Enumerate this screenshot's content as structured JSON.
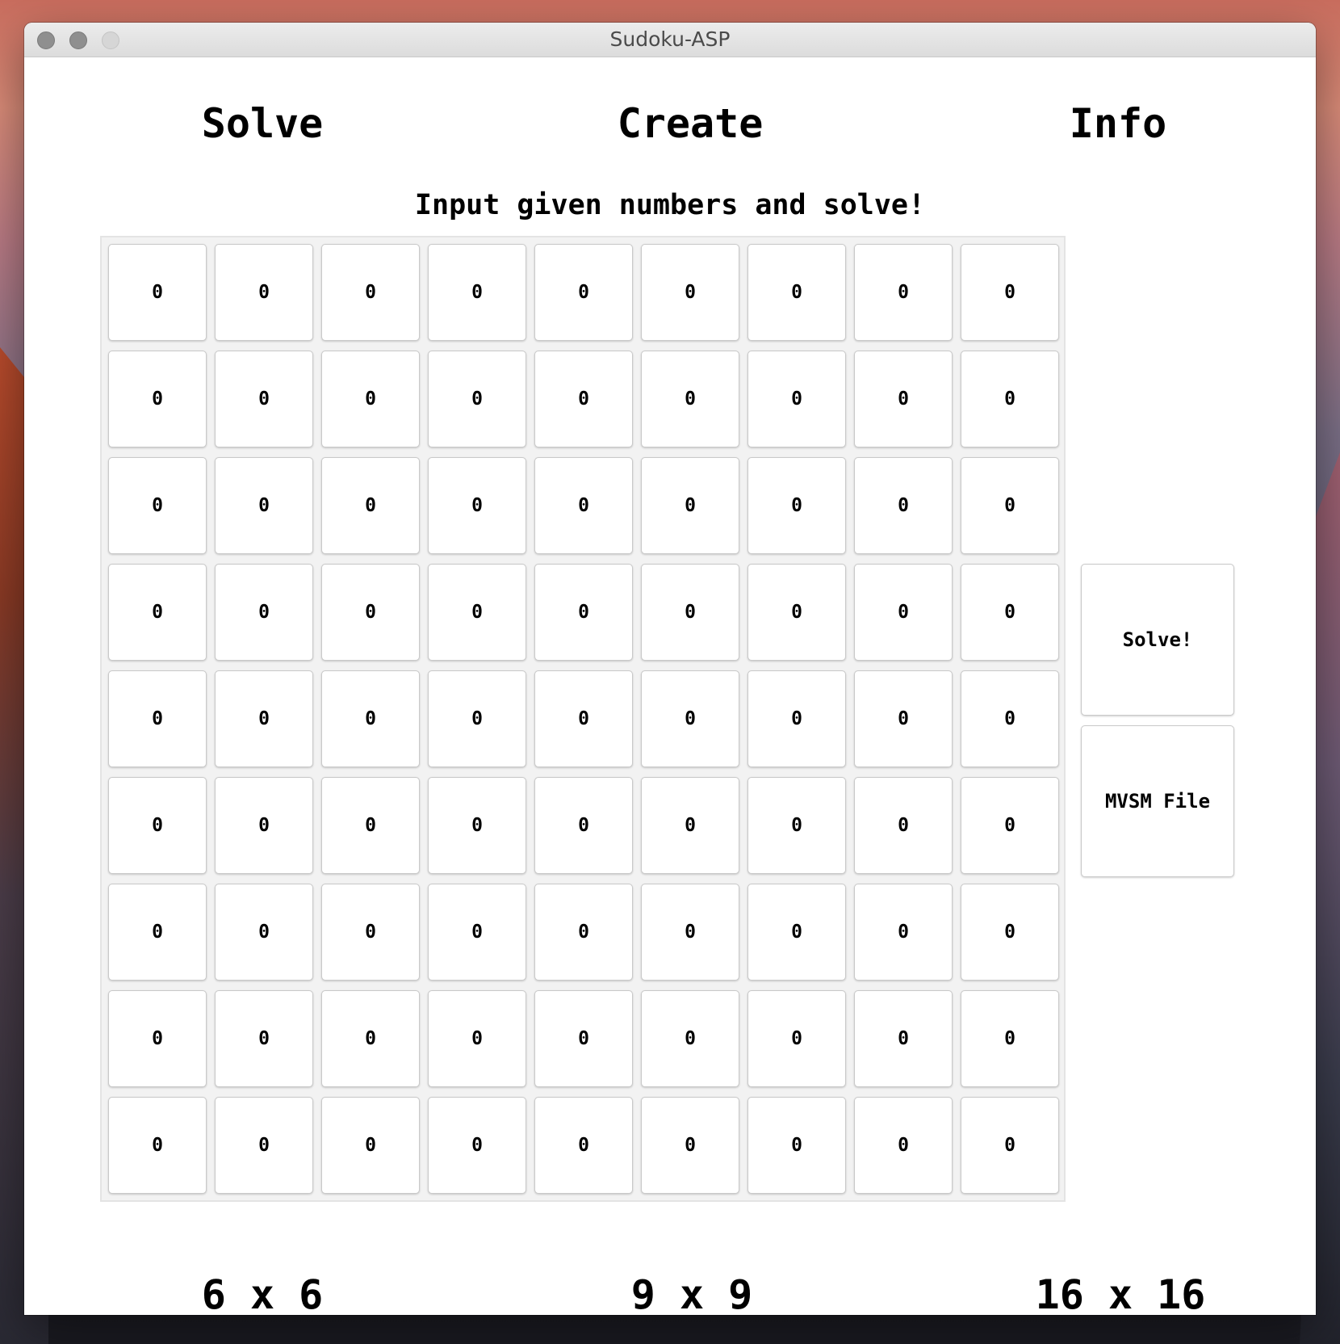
{
  "window": {
    "title": "Sudoku-ASP"
  },
  "nav": {
    "solve": "Solve",
    "create": "Create",
    "info": "Info"
  },
  "instruction": "Input given numbers and solve!",
  "board": {
    "rows": 9,
    "cols": 9,
    "values": [
      [
        "0",
        "0",
        "0",
        "0",
        "0",
        "0",
        "0",
        "0",
        "0"
      ],
      [
        "0",
        "0",
        "0",
        "0",
        "0",
        "0",
        "0",
        "0",
        "0"
      ],
      [
        "0",
        "0",
        "0",
        "0",
        "0",
        "0",
        "0",
        "0",
        "0"
      ],
      [
        "0",
        "0",
        "0",
        "0",
        "0",
        "0",
        "0",
        "0",
        "0"
      ],
      [
        "0",
        "0",
        "0",
        "0",
        "0",
        "0",
        "0",
        "0",
        "0"
      ],
      [
        "0",
        "0",
        "0",
        "0",
        "0",
        "0",
        "0",
        "0",
        "0"
      ],
      [
        "0",
        "0",
        "0",
        "0",
        "0",
        "0",
        "0",
        "0",
        "0"
      ],
      [
        "0",
        "0",
        "0",
        "0",
        "0",
        "0",
        "0",
        "0",
        "0"
      ],
      [
        "0",
        "0",
        "0",
        "0",
        "0",
        "0",
        "0",
        "0",
        "0"
      ]
    ]
  },
  "actions": {
    "solve_label": "Solve!",
    "mvsm_label": "MVSM File"
  },
  "sizes": {
    "six": "6 x 6",
    "nine": "9 x 9",
    "sixteen": "16 x 16"
  }
}
